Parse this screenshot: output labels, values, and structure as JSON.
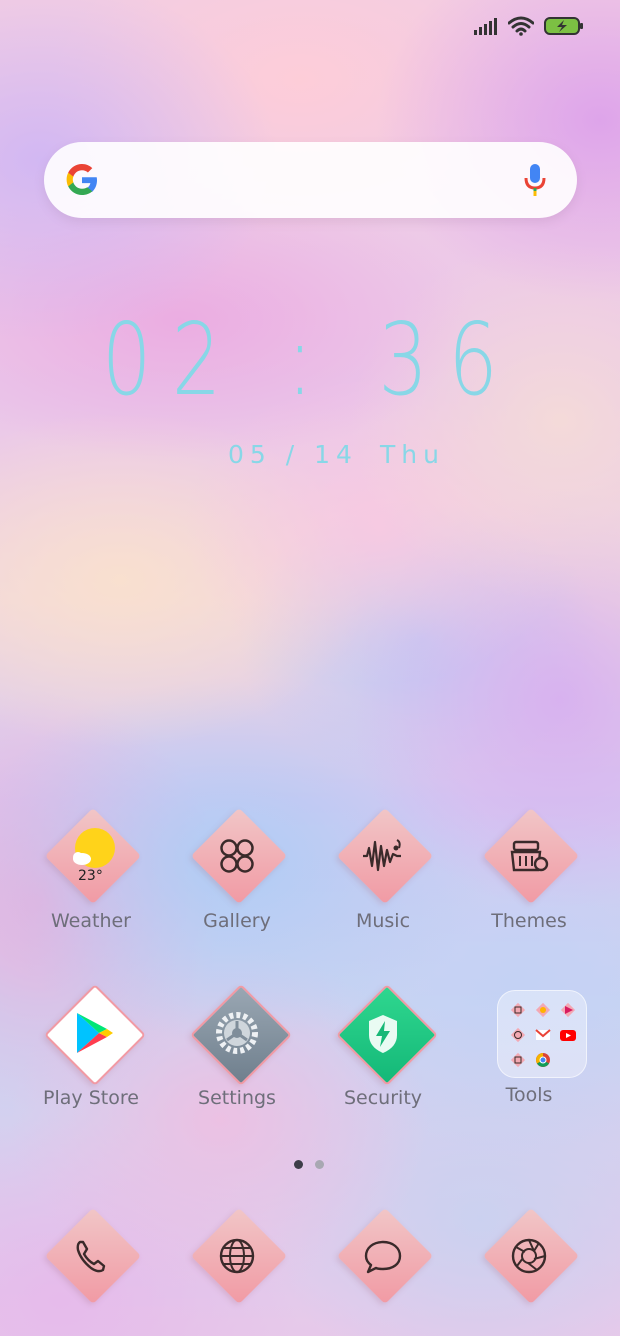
{
  "status_bar": {
    "signal_icon": "signal-bars-icon",
    "wifi_icon": "wifi-icon",
    "battery_icon": "battery-charging-icon",
    "battery_color": "#7cc043"
  },
  "search": {
    "logo": "google-g-icon",
    "mic": "microphone-icon"
  },
  "clock": {
    "time": "02 : 36",
    "date": "05 / 14",
    "day": "Thu",
    "color": "#88d7e7"
  },
  "apps_row1": [
    {
      "label": "Weather",
      "icon": "weather-icon",
      "temp": "23°"
    },
    {
      "label": "Gallery",
      "icon": "gallery-icon"
    },
    {
      "label": "Music",
      "icon": "music-icon"
    },
    {
      "label": "Themes",
      "icon": "themes-icon"
    }
  ],
  "apps_row2": [
    {
      "label": "Play Store",
      "icon": "play-store-icon"
    },
    {
      "label": "Settings",
      "icon": "settings-icon"
    },
    {
      "label": "Security",
      "icon": "security-icon"
    },
    {
      "label": "Tools",
      "icon": "tools-folder-icon"
    }
  ],
  "page_indicator": {
    "current": 1,
    "total": 2
  },
  "dock": [
    {
      "name": "phone",
      "icon": "phone-icon"
    },
    {
      "name": "browser",
      "icon": "globe-icon"
    },
    {
      "name": "messages",
      "icon": "chat-bubble-icon"
    },
    {
      "name": "camera",
      "icon": "camera-aperture-icon"
    }
  ],
  "colors": {
    "icon_gradient_start": "#f1c6c7",
    "icon_gradient_end": "#f19aa4",
    "label": "#6e6e7a"
  }
}
